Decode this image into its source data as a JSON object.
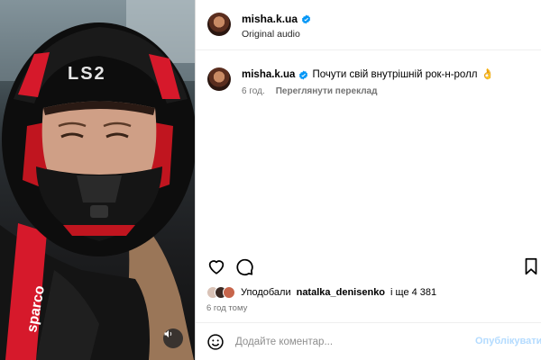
{
  "post": {
    "username": "misha.k.ua",
    "audio_label": "Original audio",
    "verified": true
  },
  "caption": {
    "username": "misha.k.ua",
    "text": "Почути свій внутрішній рок-н-ролл",
    "emoji": "👌",
    "time": "6 год.",
    "translate_label": "Переглянути переклад"
  },
  "likes": {
    "prefix": "Уподобали",
    "top_liker": "natalka_denisenko",
    "suffix": "і ще 4 381"
  },
  "time_ago": "6 год тому",
  "composer": {
    "placeholder": "Додайте коментар...",
    "post_label": "Опублікувати"
  },
  "media": {
    "helmet_brand": "LS2",
    "seatbelt_text": "sparco",
    "icon": "speaker-icon"
  },
  "colors": {
    "verified": "#0095f6",
    "helmet_red": "#d6192b",
    "post_button_disabled": "#b3dbff",
    "secondary_text": "#737373"
  }
}
